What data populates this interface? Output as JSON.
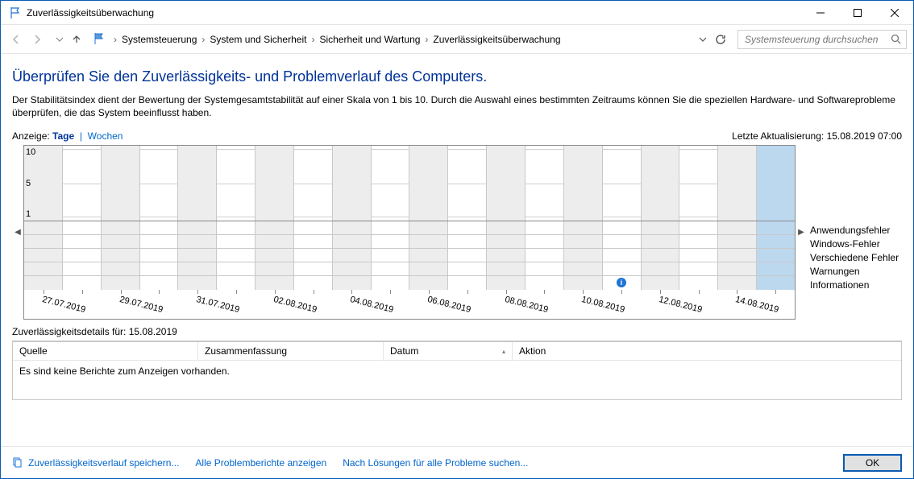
{
  "window": {
    "title": "Zuverlässigkeitsüberwachung"
  },
  "breadcrumbs": [
    "Systemsteuerung",
    "System und Sicherheit",
    "Sicherheit und Wartung",
    "Zuverlässigkeitsüberwachung"
  ],
  "search": {
    "placeholder": "Systemsteuerung durchsuchen"
  },
  "heading": "Überprüfen Sie den Zuverlässigkeits- und Problemverlauf des Computers.",
  "description": "Der Stabilitätsindex dient der Bewertung der Systemgesamtstabilität auf einer Skala von 1 bis 10. Durch die Auswahl eines bestimmten Zeitraums können Sie die speziellen Hardware- und Softwareprobleme überprüfen, die das System beeinflusst haben.",
  "view": {
    "label": "Anzeige:",
    "days": "Tage",
    "weeks": "Wochen",
    "last_update_label": "Letzte Aktualisierung:",
    "last_update_value": "15.08.2019 07:00"
  },
  "ylabels": [
    "10",
    "5",
    "1"
  ],
  "rows": [
    "Anwendungsfehler",
    "Windows-Fehler",
    "Verschiedene Fehler",
    "Warnungen",
    "Informationen"
  ],
  "dates": [
    "27.07.2019",
    "29.07.2019",
    "31.07.2019",
    "02.08.2019",
    "04.08.2019",
    "06.08.2019",
    "08.08.2019",
    "10.08.2019",
    "12.08.2019",
    "14.08.2019"
  ],
  "num_cols": 20,
  "selected_col": 19,
  "info_col": 15,
  "details": {
    "title_prefix": "Zuverlässigkeitsdetails für:",
    "date": "15.08.2019"
  },
  "columns": {
    "c1": "Quelle",
    "c2": "Zusammenfassung",
    "c3": "Datum",
    "c4": "Aktion"
  },
  "empty": "Es sind keine Berichte zum Anzeigen vorhanden.",
  "footer": {
    "save": "Zuverlässigkeitsverlauf speichern...",
    "all": "Alle Problemberichte anzeigen",
    "search": "Nach Lösungen für alle Probleme suchen...",
    "ok": "OK"
  },
  "chart_data": {
    "type": "reliability-timeline",
    "y_axis": {
      "min": 1,
      "max": 10
    },
    "date_range": [
      "27.07.2019",
      "15.08.2019"
    ],
    "events": [
      {
        "date": "11.08.2019",
        "category": "Informationen",
        "count": 1
      }
    ],
    "selected_date": "15.08.2019"
  }
}
